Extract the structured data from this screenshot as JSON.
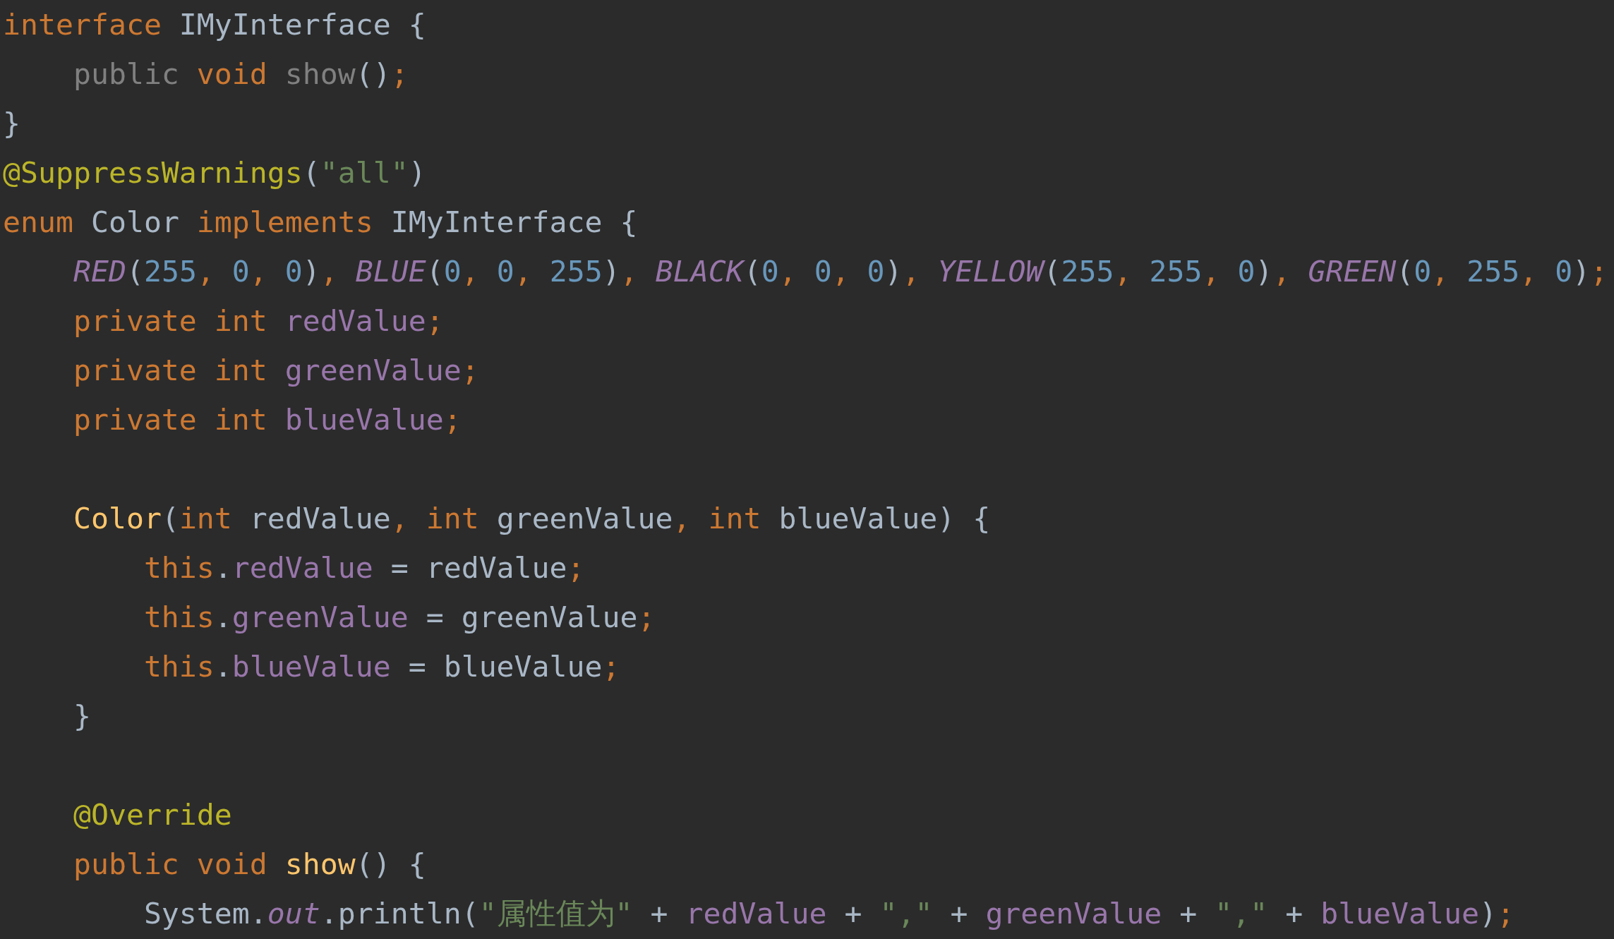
{
  "editor": {
    "lines": [
      {
        "kind": "code",
        "tokens": [
          {
            "kind": "keyword",
            "text": "interface"
          },
          {
            "kind": "plain",
            "text": " IMyInterface {"
          }
        ],
        "children": [
          {
            "kind": "code",
            "tokens": [
              {
                "kind": "muted",
                "text": "public "
              },
              {
                "kind": "keyword",
                "text": "void "
              },
              {
                "kind": "muted",
                "text": "show"
              },
              {
                "kind": "plain",
                "text": "()"
              },
              {
                "kind": "punct",
                "text": ";"
              }
            ]
          }
        ]
      },
      {
        "kind": "code",
        "tokens": [
          {
            "kind": "plain",
            "text": "}"
          }
        ]
      },
      {
        "kind": "code",
        "tokens": [
          {
            "kind": "annotation",
            "text": "@SuppressWarnings"
          },
          {
            "kind": "plain",
            "text": "("
          },
          {
            "kind": "string",
            "text": "\"all\""
          },
          {
            "kind": "plain",
            "text": ")"
          }
        ]
      },
      {
        "kind": "code",
        "tokens": [
          {
            "kind": "keyword",
            "text": "enum "
          },
          {
            "kind": "plain",
            "text": "Color "
          },
          {
            "kind": "keyword",
            "text": "implements "
          },
          {
            "kind": "plain",
            "text": "IMyInterface {"
          }
        ],
        "children": [
          {
            "kind": "code",
            "tokens": [
              {
                "kind": "constant",
                "text": "RED"
              },
              {
                "kind": "plain",
                "text": "("
              },
              {
                "kind": "number",
                "text": "255"
              },
              {
                "kind": "punct",
                "text": ", "
              },
              {
                "kind": "number",
                "text": "0"
              },
              {
                "kind": "punct",
                "text": ", "
              },
              {
                "kind": "number",
                "text": "0"
              },
              {
                "kind": "plain",
                "text": ")"
              },
              {
                "kind": "punct",
                "text": ", "
              },
              {
                "kind": "constant",
                "text": "BLUE"
              },
              {
                "kind": "plain",
                "text": "("
              },
              {
                "kind": "number",
                "text": "0"
              },
              {
                "kind": "punct",
                "text": ", "
              },
              {
                "kind": "number",
                "text": "0"
              },
              {
                "kind": "punct",
                "text": ", "
              },
              {
                "kind": "number",
                "text": "255"
              },
              {
                "kind": "plain",
                "text": ")"
              },
              {
                "kind": "punct",
                "text": ", "
              },
              {
                "kind": "constant",
                "text": "BLACK"
              },
              {
                "kind": "plain",
                "text": "("
              },
              {
                "kind": "number",
                "text": "0"
              },
              {
                "kind": "punct",
                "text": ", "
              },
              {
                "kind": "number",
                "text": "0"
              },
              {
                "kind": "punct",
                "text": ", "
              },
              {
                "kind": "number",
                "text": "0"
              },
              {
                "kind": "plain",
                "text": ")"
              },
              {
                "kind": "punct",
                "text": ", "
              },
              {
                "kind": "constant",
                "text": "YELLOW"
              },
              {
                "kind": "plain",
                "text": "("
              },
              {
                "kind": "number",
                "text": "255"
              },
              {
                "kind": "punct",
                "text": ", "
              },
              {
                "kind": "number",
                "text": "255"
              },
              {
                "kind": "punct",
                "text": ", "
              },
              {
                "kind": "number",
                "text": "0"
              },
              {
                "kind": "plain",
                "text": ")"
              },
              {
                "kind": "punct",
                "text": ", "
              },
              {
                "kind": "constant",
                "text": "GREEN"
              },
              {
                "kind": "plain",
                "text": "("
              },
              {
                "kind": "number",
                "text": "0"
              },
              {
                "kind": "punct",
                "text": ", "
              },
              {
                "kind": "number",
                "text": "255"
              },
              {
                "kind": "punct",
                "text": ", "
              },
              {
                "kind": "number",
                "text": "0"
              },
              {
                "kind": "plain",
                "text": ")"
              },
              {
                "kind": "punct",
                "text": ";"
              }
            ]
          },
          {
            "kind": "code",
            "tokens": [
              {
                "kind": "keyword",
                "text": "private int "
              },
              {
                "kind": "field",
                "text": "redValue"
              },
              {
                "kind": "punct",
                "text": ";"
              }
            ]
          },
          {
            "kind": "code",
            "tokens": [
              {
                "kind": "keyword",
                "text": "private int "
              },
              {
                "kind": "field",
                "text": "greenValue"
              },
              {
                "kind": "punct",
                "text": ";"
              }
            ]
          },
          {
            "kind": "code",
            "tokens": [
              {
                "kind": "keyword",
                "text": "private int "
              },
              {
                "kind": "field",
                "text": "blueValue"
              },
              {
                "kind": "punct",
                "text": ";"
              }
            ]
          },
          {
            "kind": "blank"
          },
          {
            "kind": "code",
            "tokens": [
              {
                "kind": "declaration",
                "text": "Color"
              },
              {
                "kind": "plain",
                "text": "("
              },
              {
                "kind": "keyword",
                "text": "int "
              },
              {
                "kind": "plain",
                "text": "redValue"
              },
              {
                "kind": "punct",
                "text": ", "
              },
              {
                "kind": "keyword",
                "text": "int "
              },
              {
                "kind": "plain",
                "text": "greenValue"
              },
              {
                "kind": "punct",
                "text": ", "
              },
              {
                "kind": "keyword",
                "text": "int "
              },
              {
                "kind": "plain",
                "text": "blueValue) {"
              }
            ],
            "children": [
              {
                "kind": "code",
                "tokens": [
                  {
                    "kind": "keyword",
                    "text": "this"
                  },
                  {
                    "kind": "plain",
                    "text": "."
                  },
                  {
                    "kind": "field",
                    "text": "redValue"
                  },
                  {
                    "kind": "plain",
                    "text": " = redValue"
                  },
                  {
                    "kind": "punct",
                    "text": ";"
                  }
                ]
              },
              {
                "kind": "code",
                "tokens": [
                  {
                    "kind": "keyword",
                    "text": "this"
                  },
                  {
                    "kind": "plain",
                    "text": "."
                  },
                  {
                    "kind": "field",
                    "text": "greenValue"
                  },
                  {
                    "kind": "plain",
                    "text": " = greenValue"
                  },
                  {
                    "kind": "punct",
                    "text": ";"
                  }
                ]
              },
              {
                "kind": "code",
                "tokens": [
                  {
                    "kind": "keyword",
                    "text": "this"
                  },
                  {
                    "kind": "plain",
                    "text": "."
                  },
                  {
                    "kind": "field",
                    "text": "blueValue"
                  },
                  {
                    "kind": "plain",
                    "text": " = blueValue"
                  },
                  {
                    "kind": "punct",
                    "text": ";"
                  }
                ]
              }
            ]
          },
          {
            "kind": "code",
            "tokens": [
              {
                "kind": "plain",
                "text": "}"
              }
            ]
          },
          {
            "kind": "blank"
          },
          {
            "kind": "code",
            "tokens": [
              {
                "kind": "annotation",
                "text": "@Override"
              }
            ]
          },
          {
            "kind": "code",
            "tokens": [
              {
                "kind": "keyword",
                "text": "public void "
              },
              {
                "kind": "declaration",
                "text": "show"
              },
              {
                "kind": "plain",
                "text": "() {"
              }
            ],
            "children": [
              {
                "kind": "code",
                "tokens": [
                  {
                    "kind": "plain",
                    "text": "System."
                  },
                  {
                    "kind": "constant",
                    "text": "out"
                  },
                  {
                    "kind": "plain",
                    "text": ".println("
                  },
                  {
                    "kind": "string",
                    "text": "\"属性值为\""
                  },
                  {
                    "kind": "plain",
                    "text": " + "
                  },
                  {
                    "kind": "field",
                    "text": "redValue"
                  },
                  {
                    "kind": "plain",
                    "text": " + "
                  },
                  {
                    "kind": "string",
                    "text": "\",\""
                  },
                  {
                    "kind": "plain",
                    "text": " + "
                  },
                  {
                    "kind": "field",
                    "text": "greenValue"
                  },
                  {
                    "kind": "plain",
                    "text": " + "
                  },
                  {
                    "kind": "string",
                    "text": "\",\""
                  },
                  {
                    "kind": "plain",
                    "text": " + "
                  },
                  {
                    "kind": "field",
                    "text": "blueValue"
                  },
                  {
                    "kind": "plain",
                    "text": ")"
                  },
                  {
                    "kind": "punct",
                    "text": ";"
                  }
                ]
              }
            ]
          }
        ]
      }
    ]
  }
}
